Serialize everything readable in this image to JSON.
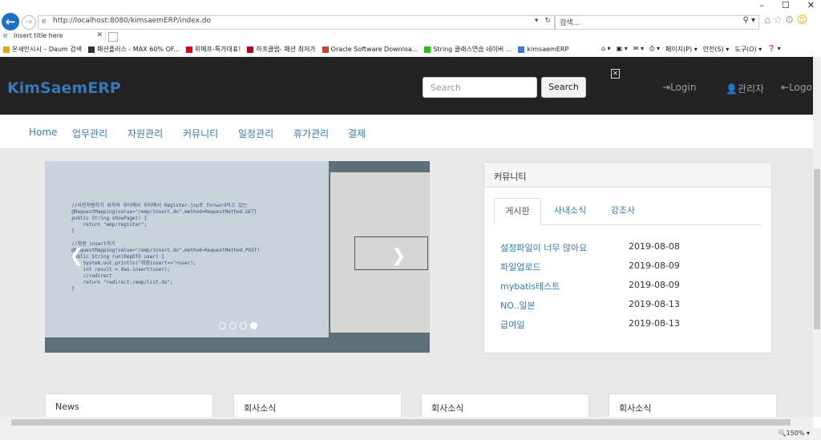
{
  "browser": {
    "url": "http://localhost:8080/kimsaemERP/index.do",
    "search_placeholder": "검색...",
    "tab_title": "Insert title here",
    "favorites": [
      {
        "label": "온새인시시 – Daum 검색",
        "color": "#e2a400"
      },
      {
        "label": "패션플러스 - MAX 60% OF...",
        "color": "#333"
      },
      {
        "label": "위메프-특가대표!",
        "color": "#e0001a"
      },
      {
        "label": "하프클럽- 패션 최저가",
        "color": "#b4001c"
      },
      {
        "label": "Oracle Software Downloa...",
        "color": "#c74634"
      },
      {
        "label": "String 클래스연습 네이버 ...",
        "color": "#1ec800"
      },
      {
        "label": "kimsaemERP",
        "color": "#3a7bd5"
      }
    ],
    "commands": [
      "페이지(P) ▾",
      "안전(S) ▾",
      "도구(O) ▾"
    ],
    "zoom": "150%"
  },
  "navbar": {
    "brand": "KimSaemERP",
    "search_placeholder": "Search",
    "search_button": "Search",
    "login": "Login",
    "admin": "관리자",
    "logout": "Logo"
  },
  "menu": [
    "Home",
    "업무관리",
    "자원관리",
    "커뮤니티",
    "일정관리",
    "휴가관리",
    "결제"
  ],
  "carousel": {
    "code_lines": [
      "  //사진처럼하기 위하여 부터에서 부터에서 Register.jsp로 forward하고 있는",
      "  @RequestMapping(value=\"/emp/insert.do\",method=RequestMethod.GET)",
      "  public String showPage() {",
      "      return \"emp/register\";",
      "  }",
      "",
      "  //회원 insert하기",
      "  @RequestMapping(value=\"/emp/insert.do\",method=RequestMethod.POST)",
      "  public String run(EmpDTO user) {",
      "      System.out.println(\"회원insert=>\"+user);",
      "      int result = dao.insert(user);",
      "      //redirect",
      "      return \"redirect:/emp/list.do\";",
      "  }"
    ]
  },
  "community": {
    "title": "커뮤니티",
    "tabs": [
      "게시판",
      "사내소식",
      "강조사"
    ],
    "posts": [
      {
        "title": "설정파일이 너무 많아요",
        "date": "2019-08-08"
      },
      {
        "title": "파일업로드",
        "date": "2019-08-09"
      },
      {
        "title": "mybatis테스트",
        "date": "2019-08-09"
      },
      {
        "title": "NO..일본",
        "date": "2019-08-13"
      },
      {
        "title": "급여일",
        "date": "2019-08-13"
      }
    ]
  },
  "cards": [
    "News",
    "회사소식",
    "회사소식",
    "회사소식"
  ]
}
